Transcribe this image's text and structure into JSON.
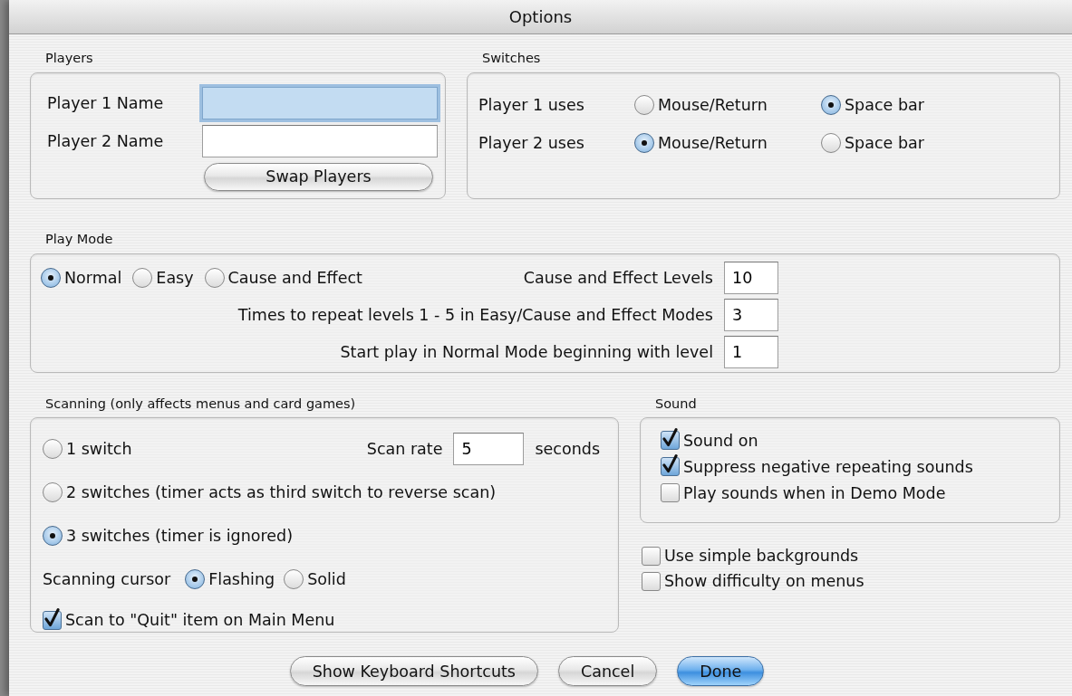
{
  "window": {
    "title": "Options"
  },
  "players": {
    "title": "Players",
    "fields": [
      {
        "label": "Player 1 Name",
        "focused": true
      },
      {
        "label": "Player 2 Name",
        "focused": false
      }
    ],
    "swap_button": "Swap Players"
  },
  "switches": {
    "title": "Switches",
    "rows": [
      {
        "label": "Player 1 uses",
        "options": [
          {
            "label": "Mouse/Return",
            "selected": false
          },
          {
            "label": "Space bar",
            "selected": true
          }
        ]
      },
      {
        "label": "Player 2 uses",
        "options": [
          {
            "label": "Mouse/Return",
            "selected": true
          },
          {
            "label": "Space bar",
            "selected": false
          }
        ]
      }
    ]
  },
  "play_mode": {
    "title": "Play Mode",
    "modes": [
      {
        "label": "Normal",
        "selected": true
      },
      {
        "label": "Easy",
        "selected": false
      },
      {
        "label": "Cause and Effect",
        "selected": false
      }
    ],
    "settings": [
      {
        "label": "Cause and Effect Levels",
        "value": "10"
      },
      {
        "label": "Times to repeat levels 1 - 5 in Easy/Cause and Effect Modes",
        "value": "3"
      },
      {
        "label": "Start play in Normal Mode beginning with level",
        "value": "1"
      }
    ]
  },
  "scanning": {
    "title": "Scanning (only affects menus and card games)",
    "options": [
      {
        "label": "1 switch",
        "selected": false
      },
      {
        "label": "2 switches (timer acts as third switch to reverse scan)",
        "selected": false
      },
      {
        "label": "3 switches (timer is ignored)",
        "selected": true
      }
    ],
    "scan_rate": {
      "label": "Scan rate",
      "value": "5",
      "unit": "seconds"
    },
    "cursor": {
      "label": "Scanning cursor",
      "options": [
        {
          "label": "Flashing",
          "selected": true
        },
        {
          "label": "Solid",
          "selected": false
        }
      ]
    },
    "quit_item": {
      "label": "Scan to \"Quit\" item on Main Menu",
      "checked": true
    }
  },
  "sound": {
    "title": "Sound",
    "items": [
      {
        "label": "Sound on",
        "checked": true
      },
      {
        "label": "Suppress negative repeating sounds",
        "checked": true
      },
      {
        "label": "Play sounds when in Demo Mode",
        "checked": false
      }
    ]
  },
  "other_options": [
    {
      "label": "Use simple backgrounds",
      "checked": false
    },
    {
      "label": "Show difficulty on menus",
      "checked": false
    }
  ],
  "buttons": [
    {
      "label": "Show Keyboard Shortcuts",
      "default": false
    },
    {
      "label": "Cancel",
      "default": false
    },
    {
      "label": "Done",
      "default": true
    }
  ]
}
